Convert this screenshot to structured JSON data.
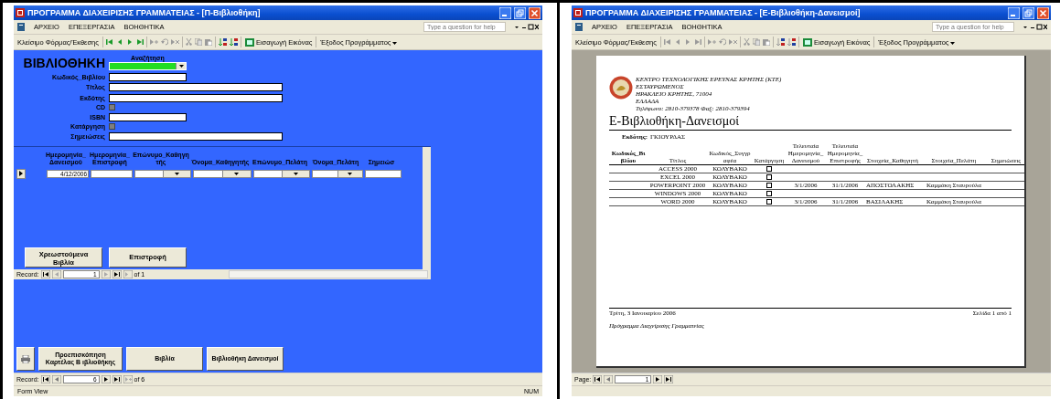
{
  "form_window": {
    "title": "ΠΡΟΓΡΑΜΜΑ ΔΙΑΧΕΙΡΙΣΗΣ ΓΡΑΜΜΑΤΕΙΑΣ - [Π-Βιβλιοθήκη]",
    "menu": [
      "ΑΡΧΕΙΟ",
      "ΕΠΕΞΕΡΓΑΣΙΑ",
      "ΒΟΗΘΗΤΙΚΑ"
    ],
    "help_placeholder": "Type a question for help",
    "toolbar": {
      "close_label": "Κλείσιμο Φόρμας/Έκθεσης",
      "nav_enabled": true,
      "insert_image": "Εισαγωγή Εικόνας",
      "exit_menu": "Έξοδος Προγράμματος"
    },
    "heading": "ΒΙΒΛΙΟΘΗΚΗ",
    "search_label": "Αναζήτηση",
    "fields": [
      {
        "label": "Κωδικός_Βιβλίου",
        "kind": "short"
      },
      {
        "label": "Τίτλος",
        "kind": "long"
      },
      {
        "label": "Εκδότης",
        "kind": "long"
      },
      {
        "label": "CD",
        "kind": "checkbox",
        "checked": false
      },
      {
        "label": "ISBN",
        "kind": "short"
      },
      {
        "label": "Κατάργηση",
        "kind": "checkbox",
        "checked": false
      },
      {
        "label": "Σημειώσεις",
        "kind": "long"
      }
    ],
    "subform": {
      "columns": [
        {
          "label": "Ημερομηνία_Δανεισμού",
          "kind": "text",
          "value": "4/12/2006"
        },
        {
          "label": "Ημερομηνία_Επιστροφή",
          "kind": "text"
        },
        {
          "label": "Επώνυμο_Καθηγητής",
          "kind": "combo"
        },
        {
          "label": "Όνομα_Καθηγητής",
          "kind": "combo"
        },
        {
          "label": "Επώνυμο_Πελάτη",
          "kind": "combo"
        },
        {
          "label": "Όνομα_Πελάτη",
          "kind": "combo"
        },
        {
          "label": "Σημειώσ",
          "kind": "text"
        }
      ],
      "buttons": [
        "Χρεωστούμενα Βιβλία",
        "Επιστροφή"
      ],
      "nav": {
        "label": "Record:",
        "current": "1",
        "total": "of 1"
      }
    },
    "buttons": [
      "Προεπισκόπηση Καρτέλας Β ιβλιοθήκης",
      "Βιβλία",
      "Βιβλιοθήκη Δανεισμοί"
    ],
    "nav": {
      "label": "Record:",
      "current": "6",
      "total": "of 6"
    },
    "status": {
      "mode": "Form View",
      "indicator": "NUM"
    }
  },
  "report_window": {
    "title": "ΠΡΟΓΡΑΜΜΑ ΔΙΑΧΕΙΡΙΣΗΣ ΓΡΑΜΜΑΤΕΙΑΣ - [Ε-Βιβλιοθήκη-Δανεισμοί]",
    "menu": [
      "ΑΡΧΕΙΟ",
      "ΕΠΕΞΕΡΓΑΣΙΑ",
      "ΒΟΗΘΗΤΙΚΑ"
    ],
    "help_placeholder": "Type a question for help",
    "toolbar": {
      "close_label": "Κλείσιμο Φόρμας/Έκθεσης",
      "nav_enabled": false,
      "insert_image": "Εισαγωγή Εικόνας",
      "exit_menu": "Έξοδος Προγράμματος"
    },
    "report": {
      "address": [
        "ΚΕΝΤΡΟ ΤΕΧΝΟΛΟΓΙΚΗΣ ΕΡΕΥΝΑΣ ΚΡΗΤΗΣ (ΚΤΕ)",
        "ΕΣΤΑΥΡΩΜΕΝΟΣ",
        "ΗΡΑΚΛΕΙΟ ΚΡΗΤΗΣ, 71004",
        "ΕΛΛΑΔΑ",
        "Τηλέφωνο: 2810-379378 Φαξ: 2810-379394"
      ],
      "title": "Ε-Βιβλιοθήκη-Δανεισμοί",
      "publisher_label": "Εκδότης:",
      "publisher": "ΓΚΙΟΥΡΔΑΣ",
      "columns": [
        "Κωδικός_Βιβλίου",
        "Τίτλος",
        "Κωδικός_Συγγραφέα",
        "Κατάργηση",
        "Τελευταία Ημερομηνία_Δανεισμού",
        "Τελευταία Ημερομηνία_Επιστροφής",
        "Στοιχεία_Καθηγητή",
        "Στοιχεία_Πελάτη",
        "Σημειώσεις"
      ],
      "rows": [
        {
          "title": "ACCESS 2000",
          "author": "ΚΟΛΥΒΑΚΟ",
          "discontinued": false
        },
        {
          "title": "EXCEL 2000",
          "author": "ΚΟΛΥΒΑΚΟ",
          "discontinued": false
        },
        {
          "title": "POWERPOINT 2000",
          "author": "ΚΟΛΥΒΑΚΟ",
          "discontinued": false,
          "loan_date": "3/1/2006",
          "return_date": "31/1/2006",
          "teacher": "ΑΠΟΣΤΟΛΑΚΗΣ",
          "client": "Καμμάκη Σταυρούλα"
        },
        {
          "title": "WINDOWS 2000",
          "author": "ΚΟΛΥΒΑΚΟ",
          "discontinued": false
        },
        {
          "title": "WORD 2000",
          "author": "ΚΟΛΥΒΑΚΟ",
          "discontinued": false,
          "loan_date": "3/1/2006",
          "return_date": "31/1/2006",
          "teacher": "ΒΑΣΙΛΑΚΗΣ",
          "client": "Καμμάκη Σταυρούλα"
        }
      ],
      "footer_date": "Τρίτη, 3 Ιανουαρίου 2006",
      "footer_page": "Σελίδα 1 από 1",
      "footer_program": "Πρόγραμμα Διαχείρισης Γραμματείας"
    },
    "nav": {
      "label": "Page:",
      "current": "1"
    }
  }
}
